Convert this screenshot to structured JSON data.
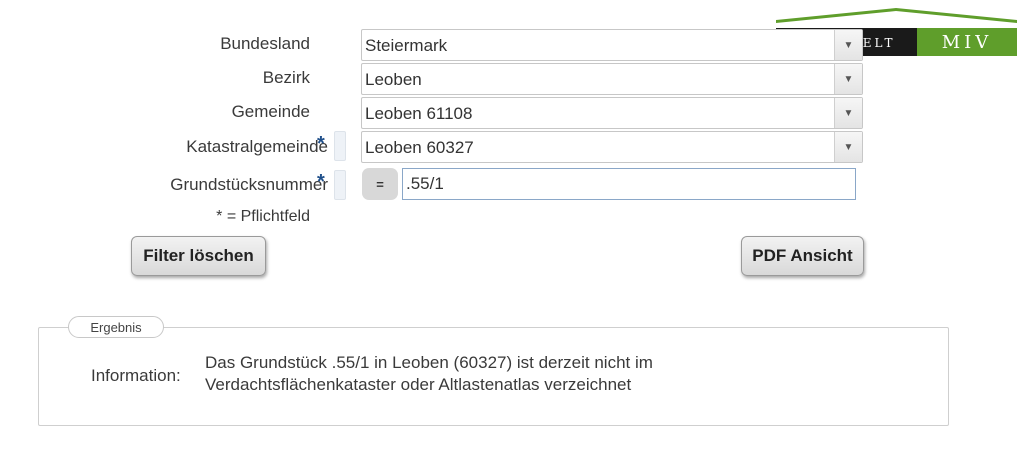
{
  "form": {
    "fields": [
      {
        "label": "Bundesland",
        "value": "Steiermark",
        "required": false
      },
      {
        "label": "Bezirk",
        "value": "Leoben",
        "required": false
      },
      {
        "label": "Gemeinde",
        "value": "Leoben 61108",
        "required": false
      },
      {
        "label": "Katastralgemeinde",
        "value": "Leoben 60327",
        "required": true
      },
      {
        "label": "Grundstücksnummer",
        "value": ".55/1",
        "required": true,
        "operator": "="
      }
    ],
    "required_star": "*",
    "required_note": "* = Pflichtfeld"
  },
  "buttons": {
    "clear": "Filter löschen",
    "pdf": "PDF Ansicht"
  },
  "result": {
    "legend": "Ergebnis",
    "info_label": "Information:",
    "info_line1": "Das Grundstück .55/1 in Leoben (60327) ist derzeit nicht im",
    "info_line2": "Verdachtsflächenkataster oder Altlastenatlas verzeichnet"
  },
  "logo": {
    "left_text": "Böchzelt",
    "right_text": "MIV",
    "colors": {
      "dark": "#1a1a1a",
      "green": "#5f9e2b"
    }
  },
  "icons": {
    "dropdown": "chevron-down-icon"
  }
}
